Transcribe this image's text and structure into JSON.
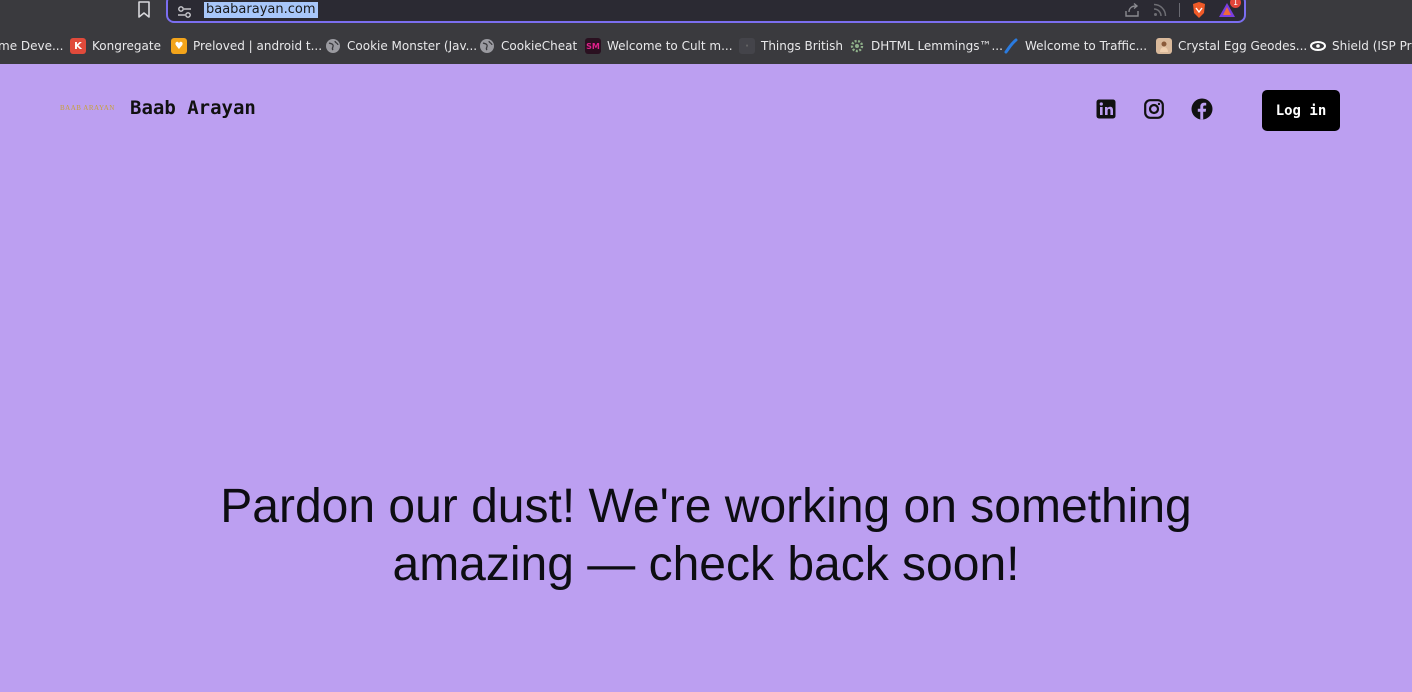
{
  "browser": {
    "url": "baabarayan.com",
    "shield_badge": "1",
    "bookmarks": [
      {
        "label": "me Deve...",
        "icon": "globe-icon",
        "color": "#3a3a3e"
      },
      {
        "label": "Kongregate",
        "icon": "kongregate-icon",
        "color": "#e04a3b"
      },
      {
        "label": "Preloved | android t...",
        "icon": "preloved-icon",
        "color": "#f3a41b"
      },
      {
        "label": "Cookie Monster (Jav...",
        "icon": "globe-icon",
        "color": "#9a9aa0"
      },
      {
        "label": "CookieCheat",
        "icon": "globe-icon",
        "color": "#9a9aa0"
      },
      {
        "label": "Welcome to Cult m...",
        "icon": "cult-icon",
        "color": "#c21a6e"
      },
      {
        "label": "Things British",
        "icon": "things-british-icon",
        "color": "#44444a"
      },
      {
        "label": "DHTML Lemmings™...",
        "icon": "gear-icon",
        "color": "#6f8f6a"
      },
      {
        "label": "Welcome to Traffic...",
        "icon": "traffic-icon",
        "color": "#2a7be0"
      },
      {
        "label": "Crystal Egg Geodes...",
        "icon": "crystal-egg-icon",
        "color": "#d9b99b"
      },
      {
        "label": "Shield (ISP Prog",
        "icon": "shield-isp-icon",
        "color": "#222"
      }
    ]
  },
  "site": {
    "logo_text": "BAAB ARAYAN",
    "title": "Baab Arayan",
    "social": [
      "linkedin-icon",
      "instagram-icon",
      "facebook-icon"
    ],
    "login_label": "Log in",
    "hero_text": "Pardon our dust! We're working on something amazing — check back soon!"
  },
  "colors": {
    "background": "#bc9ff1",
    "chrome": "#3a3a3e",
    "accent": "#7b6ef0"
  }
}
